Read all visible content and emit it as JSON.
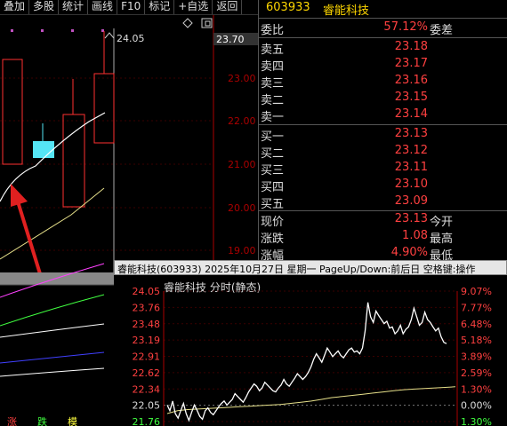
{
  "toolbar": {
    "items": [
      "叠加",
      "多股",
      "统计",
      "画线",
      "F10",
      "标记",
      "+自选",
      "返回"
    ]
  },
  "kchart": {
    "high_marker": "24.05",
    "current_price_tag": "23.70",
    "y_ticks": [
      "23.00",
      "22.00",
      "21.00",
      "20.00",
      "19.00"
    ],
    "bottom_labels": [
      "涨",
      "跌",
      "模"
    ],
    "icons": [
      "diamond-icon",
      "restore-window-icon"
    ],
    "colors": {
      "up": "#ff3030",
      "flat": "#55e5f5",
      "ma_white": "#ffffff",
      "ma_yellow": "#e6e08a",
      "ma_magenta": "#ff40ff",
      "ma_green": "#40ff40",
      "ma_blue": "#4040ff"
    }
  },
  "quote": {
    "code": "603933",
    "name": "睿能科技",
    "weibi_label": "委比",
    "weibi_value": "57.12%",
    "weicha_label": "委差",
    "asks": [
      {
        "label": "卖五",
        "price": "23.18"
      },
      {
        "label": "卖四",
        "price": "23.17"
      },
      {
        "label": "卖三",
        "price": "23.16"
      },
      {
        "label": "卖二",
        "price": "23.15"
      },
      {
        "label": "卖一",
        "price": "23.14"
      }
    ],
    "bids": [
      {
        "label": "买一",
        "price": "23.13"
      },
      {
        "label": "买二",
        "price": "23.12"
      },
      {
        "label": "买三",
        "price": "23.11"
      },
      {
        "label": "买四",
        "price": "23.10"
      },
      {
        "label": "买五",
        "price": "23.09"
      }
    ],
    "stats": [
      {
        "label": "现价",
        "value": "23.13",
        "suffix": "今开"
      },
      {
        "label": "涨跌",
        "value": "1.08",
        "suffix": "最高"
      },
      {
        "label": "涨幅",
        "value": "4.90%",
        "suffix": "最低"
      }
    ]
  },
  "intraday": {
    "title": "睿能科技(603933)  2025年10月27日  星期一  PageUp/Down:前后日  空格键:操作",
    "caption": "睿能科技   分时(静态)",
    "price_labels": [
      "24.05",
      "23.76",
      "23.48",
      "23.19",
      "22.91",
      "22.62",
      "22.34",
      "22.05",
      "21.76"
    ],
    "pct_labels": [
      "9.07%",
      "7.77%",
      "6.48%",
      "5.18%",
      "3.89%",
      "2.59%",
      "1.30%",
      "0.00%",
      "1.30%"
    ],
    "price_axis": {
      "top": 24.05,
      "bottom": 21.76
    },
    "price_line": [
      22.05,
      21.95,
      22.12,
      21.9,
      21.82,
      21.95,
      22.08,
      21.9,
      21.78,
      21.92,
      22.05,
      21.96,
      21.85,
      21.8,
      21.95,
      22.0,
      21.92,
      21.88,
      21.95,
      22.02,
      22.08,
      22.12,
      22.05,
      22.1,
      22.15,
      22.25,
      22.2,
      22.15,
      22.1,
      22.18,
      22.28,
      22.35,
      22.42,
      22.38,
      22.3,
      22.35,
      22.45,
      22.4,
      22.35,
      22.3,
      22.28,
      22.35,
      22.4,
      22.5,
      22.42,
      22.38,
      22.45,
      22.52,
      22.6,
      22.55,
      22.5,
      22.55,
      22.62,
      22.72,
      22.85,
      22.95,
      22.88,
      22.8,
      22.92,
      23.05,
      22.98,
      22.9,
      22.95,
      23.0,
      22.92,
      22.88,
      22.95,
      23.02,
      23.05,
      22.98,
      23.0,
      22.95,
      23.05,
      23.35,
      23.85,
      23.6,
      23.5,
      23.7,
      23.62,
      23.55,
      23.48,
      23.52,
      23.4,
      23.42,
      23.3,
      23.35,
      23.45,
      23.3,
      23.38,
      23.42,
      23.55,
      23.75,
      23.6,
      23.45,
      23.5,
      23.68,
      23.55,
      23.5,
      23.42,
      23.35,
      23.4,
      23.25,
      23.15,
      23.13
    ],
    "avg_line": [
      21.9,
      21.95,
      21.97,
      21.98,
      21.99,
      22.0,
      22.01,
      22.02,
      22.03,
      22.04,
      22.05,
      22.06,
      22.08,
      22.1,
      22.12,
      22.15,
      22.18,
      22.2,
      22.22,
      22.24,
      22.26,
      22.28,
      22.3,
      22.32,
      22.33,
      22.34,
      22.35,
      22.36,
      22.37
    ]
  }
}
